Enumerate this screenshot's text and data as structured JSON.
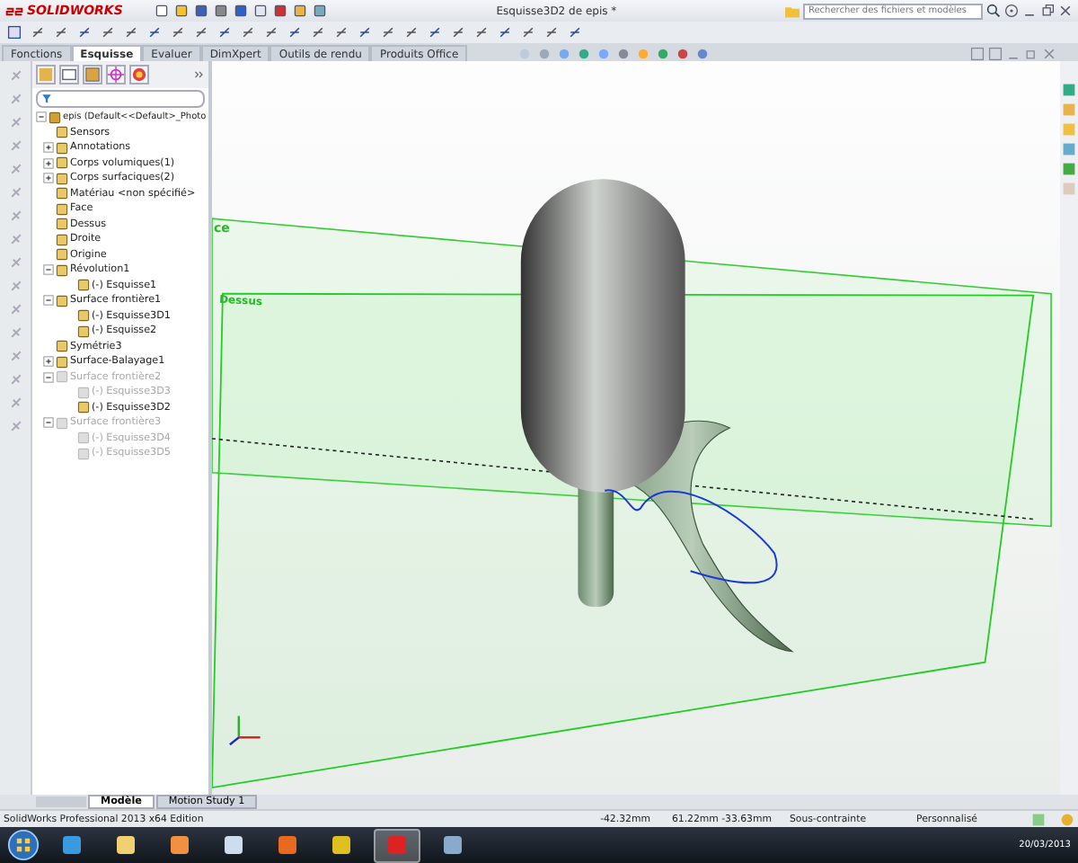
{
  "window": {
    "app": "SOLIDWORKS",
    "title": "Esquisse3D2 de epis *"
  },
  "search": {
    "placeholder": "Rechercher des fichiers et modèles"
  },
  "tabs": [
    {
      "label": "Fonctions",
      "selected": false
    },
    {
      "label": "Esquisse",
      "selected": true
    },
    {
      "label": "Evaluer",
      "selected": false
    },
    {
      "label": "DimXpert",
      "selected": false
    },
    {
      "label": "Outils de rendu",
      "selected": false
    },
    {
      "label": "Produits Office",
      "selected": false
    }
  ],
  "tree": {
    "items": [
      {
        "label": "epis  (Default<<Default>_Photo",
        "disabled": false,
        "expanded": true,
        "children": [
          {
            "label": "Sensors",
            "disabled": false
          },
          {
            "label": "Annotations",
            "disabled": false,
            "expanded": false
          },
          {
            "label": "Corps volumiques(1)",
            "disabled": false,
            "expanded": false
          },
          {
            "label": "Corps surfaciques(2)",
            "disabled": false,
            "expanded": false
          },
          {
            "label": "Matériau <non spécifié>",
            "disabled": false
          },
          {
            "label": "Face",
            "disabled": false
          },
          {
            "label": "Dessus",
            "disabled": false
          },
          {
            "label": "Droite",
            "disabled": false
          },
          {
            "label": "Origine",
            "disabled": false
          },
          {
            "label": "Révolution1",
            "disabled": false,
            "expanded": true,
            "children": [
              {
                "label": "(-) Esquisse1",
                "disabled": false
              }
            ]
          },
          {
            "label": "Surface frontière1",
            "disabled": false,
            "expanded": true,
            "children": [
              {
                "label": "(-) Esquisse3D1",
                "disabled": false
              },
              {
                "label": "(-) Esquisse2",
                "disabled": false
              }
            ]
          },
          {
            "label": "Symétrie3",
            "disabled": false
          },
          {
            "label": "Surface-Balayage1",
            "disabled": false,
            "expanded": false
          },
          {
            "label": "Surface frontière2",
            "disabled": true,
            "expanded": true,
            "children": [
              {
                "label": "(-) Esquisse3D3",
                "disabled": true
              },
              {
                "label": "(-) Esquisse3D2",
                "disabled": false
              }
            ]
          },
          {
            "label": "Surface frontière3",
            "disabled": true,
            "expanded": true,
            "children": [
              {
                "label": "(-) Esquisse3D4",
                "disabled": true
              },
              {
                "label": "(-) Esquisse3D5",
                "disabled": true
              }
            ]
          }
        ]
      }
    ]
  },
  "viewport": {
    "planes": [
      {
        "label": "ce"
      },
      {
        "label": "Dessus"
      }
    ]
  },
  "bottom_tabs": [
    {
      "label": "Modèle",
      "selected": true
    },
    {
      "label": "Motion Study 1",
      "selected": false
    }
  ],
  "status_bar": {
    "app": "SolidWorks Professional 2013 x64 Edition",
    "x": "-42.32mm",
    "yz": "61.22mm -33.63mm",
    "state": "Sous-contrainte",
    "units": "Personnalisé"
  },
  "taskbar": {
    "date": "20/03/2013"
  }
}
